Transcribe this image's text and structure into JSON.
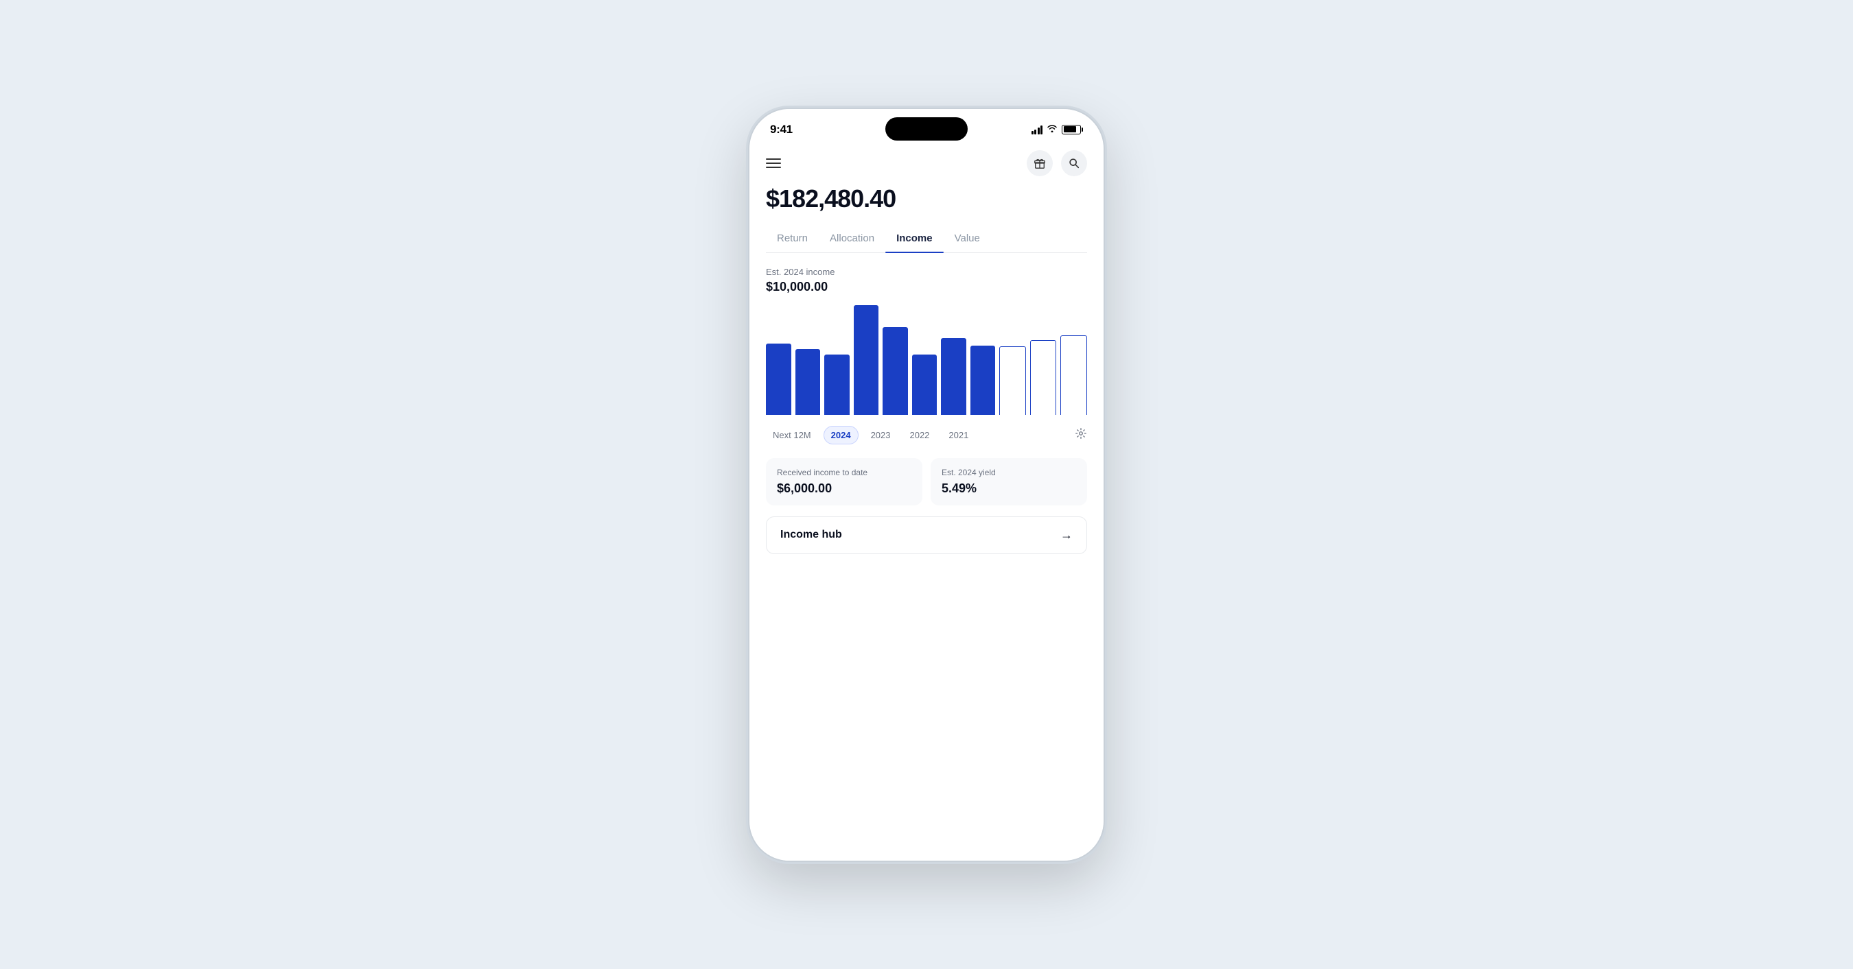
{
  "status": {
    "time": "9:41",
    "battery_level": 80
  },
  "nav": {
    "menu_label": "menu",
    "gift_label": "gift",
    "search_label": "search"
  },
  "portfolio": {
    "value": "$182,480.40"
  },
  "tabs": [
    {
      "id": "return",
      "label": "Return",
      "active": false
    },
    {
      "id": "allocation",
      "label": "Allocation",
      "active": false
    },
    {
      "id": "income",
      "label": "Income",
      "active": true
    },
    {
      "id": "value",
      "label": "Value",
      "active": false
    }
  ],
  "income_section": {
    "chart_label": "Est. 2024 income",
    "chart_amount": "$10,000.00",
    "bars": [
      {
        "type": "filled",
        "height": 65
      },
      {
        "type": "filled",
        "height": 60
      },
      {
        "type": "filled",
        "height": 55
      },
      {
        "type": "filled",
        "height": 100
      },
      {
        "type": "filled",
        "height": 80
      },
      {
        "type": "filled",
        "height": 55
      },
      {
        "type": "filled",
        "height": 70
      },
      {
        "type": "filled",
        "height": 63
      },
      {
        "type": "outline",
        "height": 62
      },
      {
        "type": "outline",
        "height": 68
      },
      {
        "type": "outline",
        "height": 72
      }
    ],
    "year_filters": [
      {
        "id": "next12m",
        "label": "Next 12M",
        "active": false
      },
      {
        "id": "2024",
        "label": "2024",
        "active": true
      },
      {
        "id": "2023",
        "label": "2023",
        "active": false
      },
      {
        "id": "2022",
        "label": "2022",
        "active": false
      },
      {
        "id": "2021",
        "label": "2021",
        "active": false
      }
    ],
    "stats": [
      {
        "id": "received",
        "label": "Received income to date",
        "value": "$6,000.00"
      },
      {
        "id": "yield",
        "label": "Est. 2024 yield",
        "value": "5.49%"
      }
    ],
    "income_hub_label": "Income hub",
    "income_hub_arrow": "→"
  }
}
